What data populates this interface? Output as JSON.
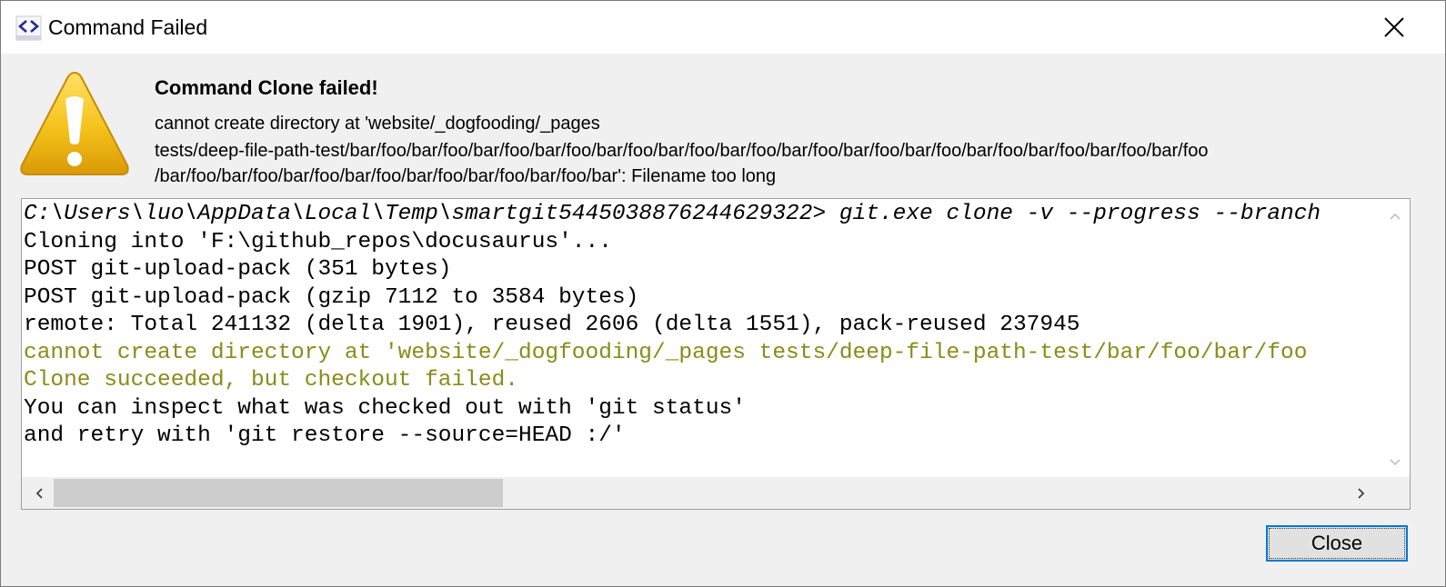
{
  "window": {
    "title": "Command Failed",
    "icon": "code-brackets-icon",
    "close_icon": "close-icon"
  },
  "message": {
    "icon": "warning-icon",
    "title": "Command Clone failed!",
    "lines": [
      "cannot create directory at 'website/_dogfooding/_pages",
      "tests/deep-file-path-test/bar/foo/bar/foo/bar/foo/bar/foo/bar/foo/bar/foo/bar/foo/bar/foo/bar/foo/bar/foo/bar/foo/bar/foo/bar/foo/bar/foo",
      "/bar/foo/bar/foo/bar/foo/bar/foo/bar/foo/bar/foo/bar/foo/bar': Filename too long"
    ]
  },
  "console": {
    "lines": [
      "C:\\Users\\luo\\AppData\\Local\\Temp\\smartgit5445038876244629322> git.exe clone -v --progress --branch",
      "Cloning into 'F:\\github_repos\\docusaurus'...",
      "POST git-upload-pack (351 bytes)",
      "POST git-upload-pack (gzip 7112 to 3584 bytes)",
      "remote: Total 241132 (delta 1901), reused 2606 (delta 1551), pack-reused 237945",
      "cannot create directory at 'website/_dogfooding/_pages tests/deep-file-path-test/bar/foo/bar/foo",
      "Clone succeeded, but checkout failed.",
      "You can inspect what was checked out with 'git status'",
      "and retry with 'git restore --source=HEAD :/'"
    ],
    "colors": {
      "normal": "#000000",
      "warning": "#8b8b1a"
    }
  },
  "buttons": {
    "close_label": "Close"
  },
  "colors": {
    "dialog_bg": "#f0f0f0",
    "focus_border": "#0078d7",
    "warning_yellow": "#f4c21b"
  }
}
